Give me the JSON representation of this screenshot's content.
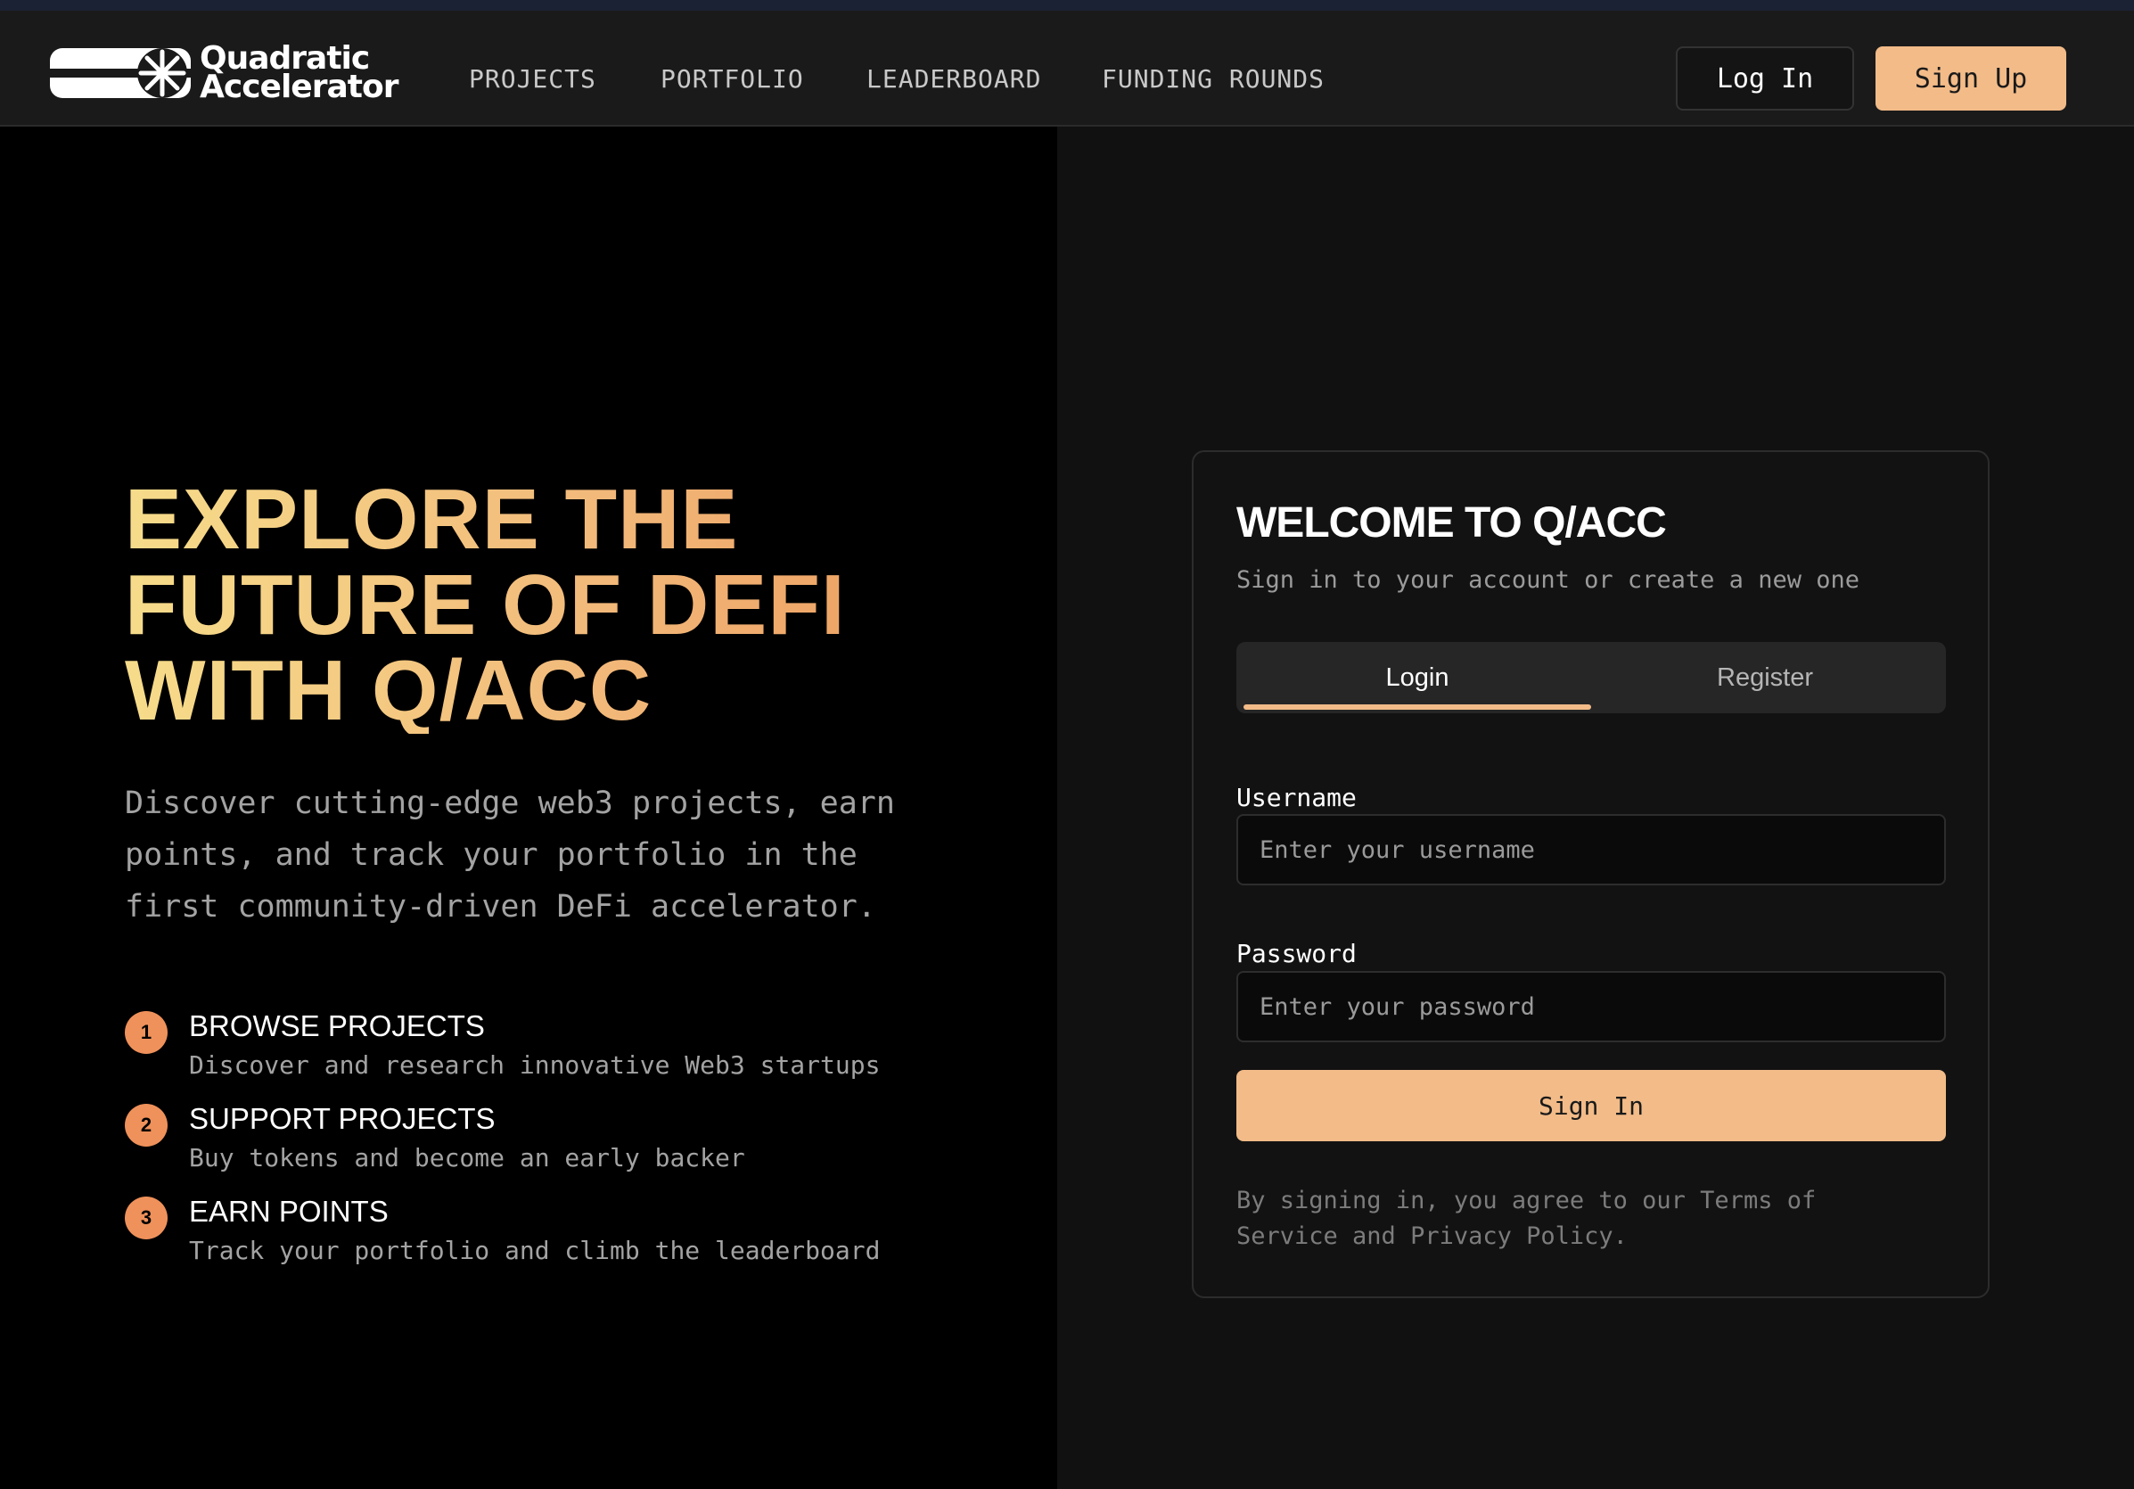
{
  "nav": {
    "logo": {
      "line1": "Quadratic",
      "line2": "Accelerator",
      "icon": "quadratic-accelerator-logo-icon"
    },
    "links": [
      "PROJECTS",
      "PORTFOLIO",
      "LEADERBOARD",
      "FUNDING ROUNDS"
    ],
    "login_label": "Log In",
    "signup_label": "Sign Up"
  },
  "hero": {
    "title_line1": "EXPLORE THE",
    "title_line2": "FUTURE OF DEFI",
    "title_line3": "WITH Q/ACC",
    "description": "Discover cutting-edge web3 projects, earn points, and track your portfolio in the first community-driven DeFi accelerator.",
    "steps": [
      {
        "num": "1",
        "title": "BROWSE PROJECTS",
        "desc": "Discover and research innovative Web3 startups"
      },
      {
        "num": "2",
        "title": "SUPPORT PROJECTS",
        "desc": "Buy tokens and become an early backer"
      },
      {
        "num": "3",
        "title": "EARN POINTS",
        "desc": "Track your portfolio and climb the leaderboard"
      }
    ]
  },
  "auth": {
    "title": "WELCOME TO Q/ACC",
    "subtitle": "Sign in to your account or create a new one",
    "tabs": {
      "login": "Login",
      "register": "Register",
      "active": "Login"
    },
    "username": {
      "label": "Username",
      "placeholder": "Enter your username",
      "value": ""
    },
    "password": {
      "label": "Password",
      "placeholder": "Enter your password",
      "value": ""
    },
    "submit_label": "Sign In",
    "terms": "By signing in, you agree to our Terms of Service and Privacy Policy."
  },
  "colors": {
    "accent": "#f2bb88",
    "step_badge": "#ef915a",
    "hero_gradient_start": "#f6dc8a",
    "hero_gradient_end": "#ec9a5c",
    "top_strip": "#1b2233"
  }
}
